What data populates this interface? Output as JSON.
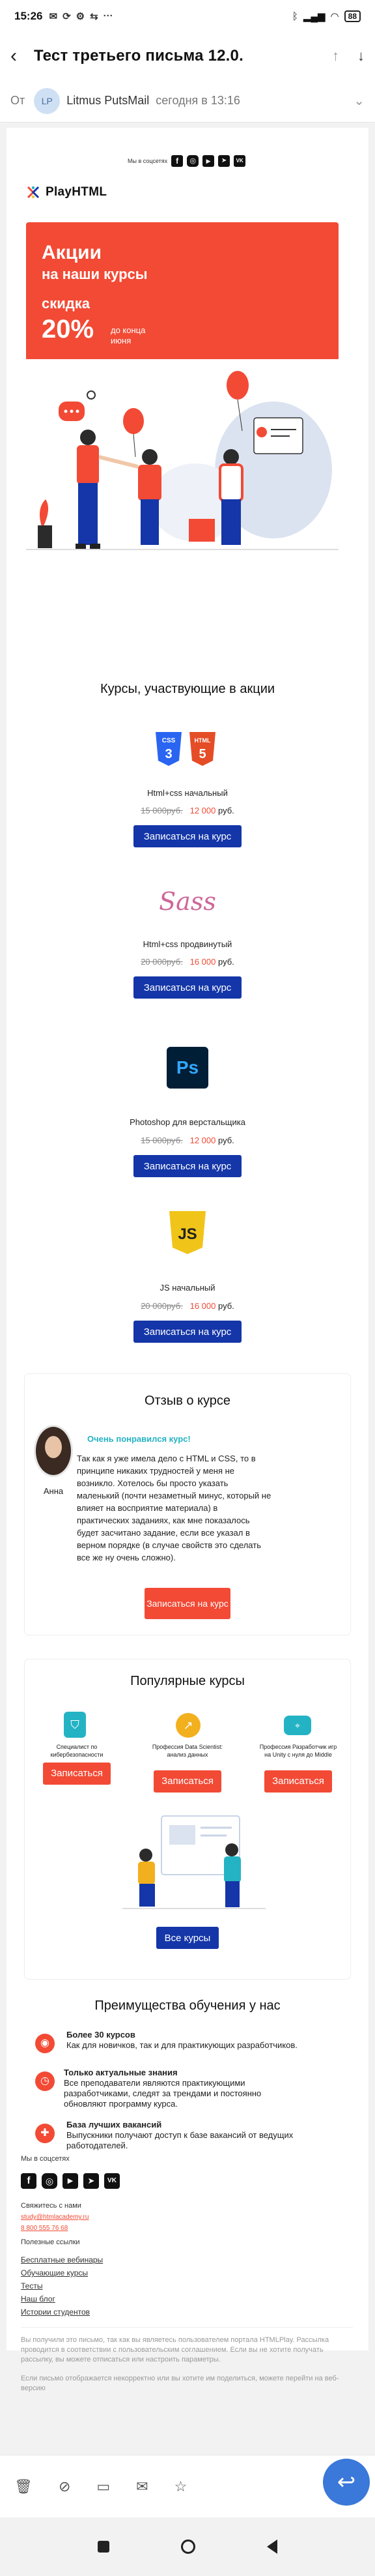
{
  "status_bar": {
    "time": "15:26",
    "battery": "88"
  },
  "header": {
    "subject": "Тест третьего письма 12.0."
  },
  "sender": {
    "from_label": "От",
    "initials": "LP",
    "name": "Litmus PutsMail",
    "date": "сегодня в 13:16"
  },
  "email": {
    "social_label": "Мы в соцсетях",
    "logo_text": "PlayHTML",
    "promo": {
      "line1": "Акции",
      "line2": "на наши курсы",
      "line3": "скидка",
      "percent": "20%",
      "until": "до конца\nиюня"
    },
    "courses_title": "Курсы, участвующие в акции",
    "courses": [
      {
        "name": "Html+css начальный",
        "old_price": "15 000руб.",
        "new_price": "12 000",
        "currency": "руб.",
        "button": "Записаться на курс",
        "icon": "html-css-icon"
      },
      {
        "name": "Html+css продвинутый",
        "old_price": "20 000руб.",
        "new_price": "16 000",
        "currency": "руб.",
        "button": "Записаться на курс",
        "icon": "sass-icon"
      },
      {
        "name": "Photoshop для верстальщика",
        "old_price": "15 000руб.",
        "new_price": "12 000",
        "currency": "руб.",
        "button": "Записаться на курс",
        "icon": "photoshop-icon"
      },
      {
        "name": "JS начальный",
        "old_price": "20 000руб.",
        "new_price": "16 000",
        "currency": "руб.",
        "button": "Записаться на курс",
        "icon": "js-icon"
      }
    ],
    "review": {
      "title": "Отзыв о курсе",
      "liked": "Очень понравился курс!",
      "author": "Анна",
      "text": "Так как я уже имела дело с HTML и CSS, то в принципе никаких трудностей у меня не возникло. Хотелось бы просто указать маленький (почти незаметный минус, который не влияет на восприятие материала) в практических заданиях, как мне показалось будет засчитано задание, если все указал в верном порядке (в случае свойств это сделать все же ну очень сложно).",
      "button": "Записаться на курс"
    },
    "popular": {
      "title": "Популярные курсы",
      "items": [
        {
          "name": "Специалист по кибербезопасности",
          "button": "Записаться"
        },
        {
          "name": "Профессия Data Scientist: анализ данных",
          "button": "Записаться"
        },
        {
          "name": "Профессия Разработчик игр на Unity с нуля до Middle",
          "button": "Записаться"
        }
      ],
      "all_button": "Все курсы"
    },
    "advantages": {
      "title": "Преимущества обучения у нас",
      "items": [
        {
          "title": "Более 30 курсов",
          "text": "Как для новичков, так и для практикующих разработчиков."
        },
        {
          "title": "Только актуальные знания",
          "text": "Все преподаватели являются практикующими разработчиками, следят за трендами и постоянно обновляют программу курса."
        },
        {
          "title": "База лучших вакансий",
          "text": "Выпускники получают доступ к базе вакансий от ведущих работодателей."
        }
      ]
    },
    "footer": {
      "social_title": "Мы в соцсетях",
      "contact_title": "Свяжитесь с нами",
      "email": "study@htmlacademy.ru",
      "phone": "8 800 555 76 68",
      "links_title": "Полезные ссылки",
      "links": [
        "Бесплатные вебинары",
        "Обучающие курсы",
        "Тесты",
        "Наш блог",
        "Истории студентов"
      ],
      "disclaimer": "Вы получили это письмо, так как вы являетесь пользователем портала HTMLPlay. Рассылка проводится в соответствии с пользовательским соглашением. Если вы не хотите получать рассылку, вы можете отписаться или настроить параметры.",
      "view_online": "Если письмо отображается некорректно или вы хотите им поделиться, можете перейти на веб-версию"
    }
  },
  "colors": {
    "accent_red": "#f24a35",
    "brand_blue": "#1436a8",
    "teal": "#24b3c4"
  }
}
